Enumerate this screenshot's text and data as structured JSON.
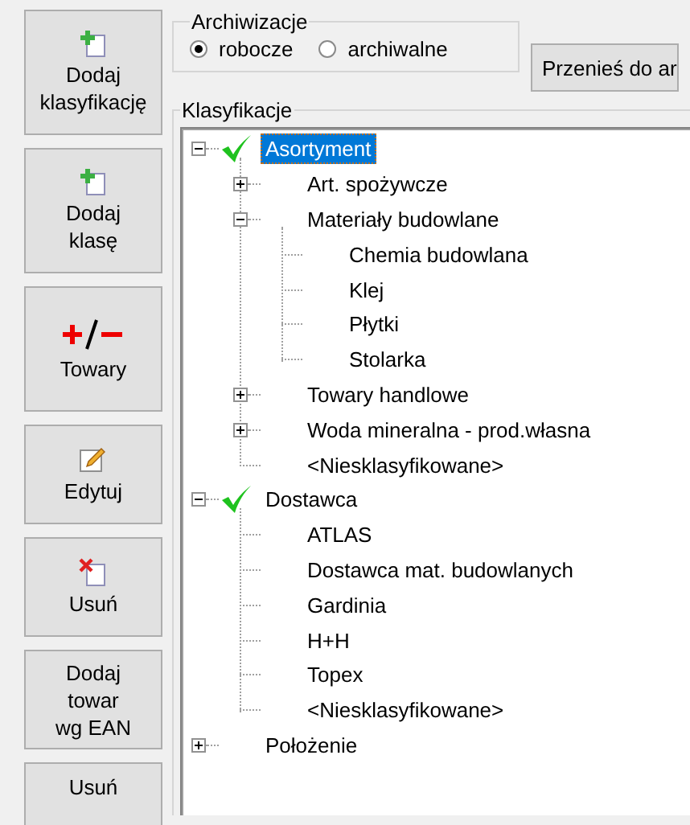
{
  "side_buttons": [
    {
      "kind": "add",
      "label_lines": [
        "Dodaj",
        "klasyfikację"
      ]
    },
    {
      "kind": "add",
      "label_lines": [
        "Dodaj",
        "klasę"
      ]
    },
    {
      "kind": "plusminus",
      "label_lines": [
        "Towary"
      ]
    },
    {
      "kind": "edit",
      "label_lines": [
        "Edytuj"
      ]
    },
    {
      "kind": "delete",
      "label_lines": [
        "Usuń"
      ]
    },
    {
      "kind": "text",
      "label_lines": [
        "Dodaj",
        "towar",
        "wg EAN"
      ]
    },
    {
      "kind": "text",
      "label_lines": [
        "Usuń"
      ]
    }
  ],
  "archiwizacje": {
    "title": "Archiwizacje",
    "options": [
      {
        "label": "robocze",
        "selected": true
      },
      {
        "label": "archiwalne",
        "selected": false
      }
    ]
  },
  "move_button": "Przenieś do ar",
  "klasyfikacje": {
    "title": "Klasyfikacje",
    "tree": [
      {
        "label": "Asortyment",
        "checked": true,
        "selected": true,
        "expanded": true,
        "children": [
          {
            "label": "Art. spożywcze",
            "expanded": false,
            "selected": false
          },
          {
            "label": "Materiały budowlane",
            "expanded": true,
            "selected": false,
            "children": [
              {
                "label": "Chemia budowlana",
                "selected": false
              },
              {
                "label": "Klej",
                "selected": false
              },
              {
                "label": "Płytki",
                "selected": false
              },
              {
                "label": "Stolarka",
                "selected": false
              }
            ]
          },
          {
            "label": "Towary handlowe",
            "expanded": false,
            "selected": false
          },
          {
            "label": "Woda mineralna - prod.własna",
            "expanded": false,
            "selected": false
          },
          {
            "label": "<Niesklasyfikowane>",
            "selected": false
          }
        ]
      },
      {
        "label": "Dostawca",
        "checked": true,
        "selected": false,
        "expanded": true,
        "children": [
          {
            "label": "ATLAS",
            "selected": false
          },
          {
            "label": "Dostawca mat. budowlanych",
            "selected": false
          },
          {
            "label": "Gardinia",
            "selected": false
          },
          {
            "label": "H+H",
            "selected": false
          },
          {
            "label": "Topex",
            "selected": false
          },
          {
            "label": "<Niesklasyfikowane>",
            "selected": false
          }
        ]
      },
      {
        "label": "Położenie",
        "checked": false,
        "selected": false,
        "expanded": false
      }
    ]
  }
}
